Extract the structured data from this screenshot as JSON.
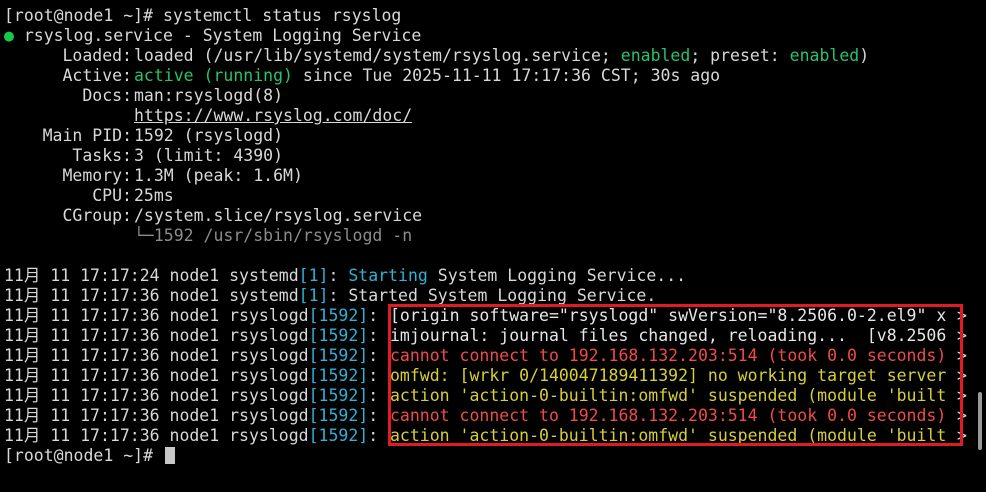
{
  "prompt": "[root@node1 ~]#",
  "command": "systemctl status rsyslog",
  "status_dot": "●",
  "unit_name": "rsyslog.service",
  "unit_sep": "-",
  "unit_desc": "System Logging Service",
  "fields": {
    "loaded_label": "Loaded:",
    "loaded_pre": "loaded (/usr/lib/systemd/system/rsyslog.service;",
    "loaded_enabled": "enabled",
    "loaded_mid": "; preset:",
    "loaded_preset": "enabled",
    "loaded_post": ")",
    "active_label": "Active:",
    "active_state": "active (running)",
    "active_since": "since Tue 2025-11-11 17:17:36 CST; 30s ago",
    "docs_label": "Docs:",
    "docs_man": "man:rsyslogd(8)",
    "docs_url": "https://www.rsyslog.com/doc/",
    "pid_label": "Main PID:",
    "pid_value": "1592 (rsyslogd)",
    "tasks_label": "Tasks:",
    "tasks_value": "3 (limit: 4390)",
    "memory_label": "Memory:",
    "memory_value": "1.3M (peak: 1.6M)",
    "cpu_label": "CPU:",
    "cpu_value": "25ms",
    "cgroup_label": "CGroup:",
    "cgroup_value": "/system.slice/rsyslog.service",
    "tree_glyph": "└─",
    "tree_process": "1592 /usr/sbin/rsyslogd -n"
  },
  "log_lines": [
    {
      "prefix": "11月 11 17:17:24 node1 systemd",
      "pid": "[1]",
      "colon": ":",
      "msg_a": "Starting",
      "msg_b": " System Logging Service..."
    },
    {
      "prefix": "11月 11 17:17:36 node1 systemd",
      "pid": "[1]",
      "colon": ":",
      "msg": "Started System Logging Service."
    },
    {
      "prefix": "11月 11 17:17:36 node1 rsyslogd",
      "pid": "[1592]",
      "colon": ":",
      "msg": "[origin software=\"rsyslogd\" swVersion=\"8.2506.0-2.el9\" x",
      "tone": "w"
    },
    {
      "prefix": "11月 11 17:17:36 node1 rsyslogd",
      "pid": "[1592]",
      "colon": ":",
      "msg": "imjournal: journal files changed, reloading...  [v8.2506",
      "tone": "w"
    },
    {
      "prefix": "11月 11 17:17:36 node1 rsyslogd",
      "pid": "[1592]",
      "colon": ":",
      "msg": "cannot connect to 192.168.132.203:514 (took 0.0 seconds)",
      "tone": "r"
    },
    {
      "prefix": "11月 11 17:17:36 node1 rsyslogd",
      "pid": "[1592]",
      "colon": ":",
      "msg": "omfwd: [wrkr 0/140047189411392] no working target server",
      "tone": "y"
    },
    {
      "prefix": "11月 11 17:17:36 node1 rsyslogd",
      "pid": "[1592]",
      "colon": ":",
      "msg": "action 'action-0-builtin:omfwd' suspended (module 'built",
      "tone": "y"
    },
    {
      "prefix": "11月 11 17:17:36 node1 rsyslogd",
      "pid": "[1592]",
      "colon": ":",
      "msg": "cannot connect to 192.168.132.203:514 (took 0.0 seconds)",
      "tone": "r"
    },
    {
      "prefix": "11月 11 17:17:36 node1 rsyslogd",
      "pid": "[1592]",
      "colon": ":",
      "msg": "action 'action-0-builtin:omfwd' suspended (module 'built",
      "tone": "y"
    }
  ],
  "truncation_marker": ">",
  "final_prompt": "[root@node1 ~]#",
  "colors": {
    "background": "#000000",
    "text": "#d8d8d8",
    "green": "#28c26b",
    "cyan": "#2fb2d6",
    "yellow": "#d6cf35",
    "red": "#ef4b4b",
    "highlight_border": "#e01b24"
  }
}
